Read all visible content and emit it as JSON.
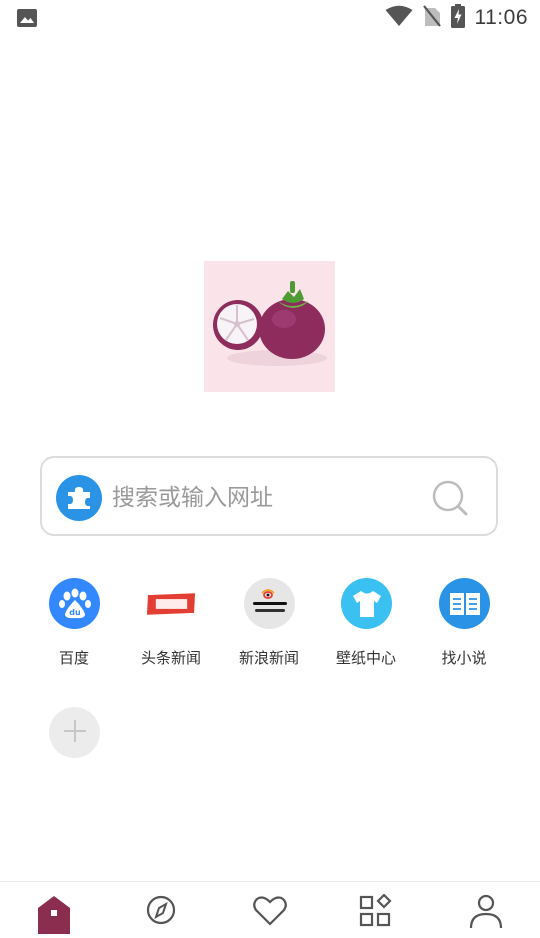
{
  "status_bar": {
    "time": "11:06",
    "icons": [
      "image-notification-icon",
      "wifi-icon",
      "no-sim-icon",
      "battery-charging-icon"
    ]
  },
  "app": {
    "logo_icon": "mangosteen-logo-icon"
  },
  "search": {
    "placeholder": "搜索或输入网址",
    "engine_icon": "puzzle-icon",
    "button_icon": "search-icon"
  },
  "shortcuts": [
    {
      "label": "百度",
      "icon": "baidu-icon",
      "color": "#3388ff"
    },
    {
      "label": "头条新闻",
      "icon": "toutiao-icon",
      "color": "#e33e33"
    },
    {
      "label": "新浪新闻",
      "icon": "sina-icon",
      "color": "#e6e6e6"
    },
    {
      "label": "壁纸中心",
      "icon": "tshirt-icon",
      "color": "#3bc0f2"
    },
    {
      "label": "找小说",
      "icon": "book-icon",
      "color": "#2a93e6"
    }
  ],
  "add_shortcut_icon": "plus-icon",
  "bottom_nav": [
    {
      "icon": "home-icon",
      "active": true,
      "color": "#8a2d4e"
    },
    {
      "icon": "compass-icon",
      "active": false
    },
    {
      "icon": "heart-icon",
      "active": false
    },
    {
      "icon": "apps-icon",
      "active": false
    },
    {
      "icon": "profile-icon",
      "active": false
    }
  ]
}
